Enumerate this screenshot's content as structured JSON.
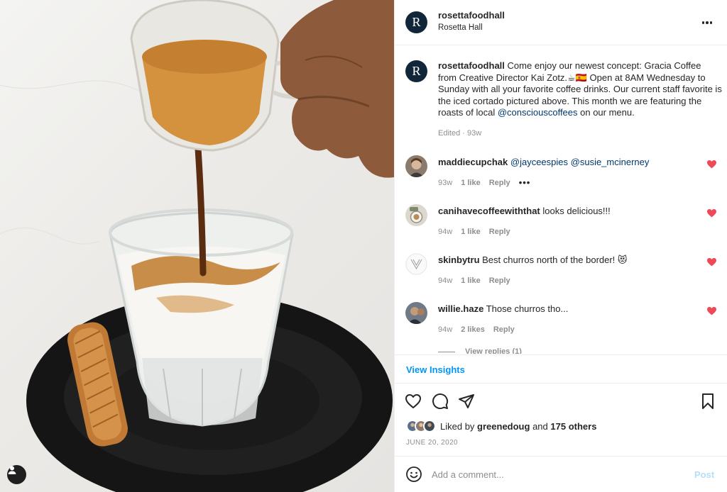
{
  "post": {
    "username": "rosettafoodhall",
    "location": "Rosetta Hall",
    "avatar_letter": "R",
    "avatar_color": "#12263a"
  },
  "caption": {
    "username": "rosettafoodhall",
    "text_part1": "Come enjoy our newest concept: Gracia Coffee from Creative Director Kai Zotz.",
    "emojis": "☕🇪🇸",
    "text_part2": " Open at 8AM Wednesday to Sunday with all your favorite coffee drinks. Our current staff favorite is the iced cortado pictured above. This month we are featuring the roasts of local ",
    "mention": "@consciouscoffees",
    "text_part3": " on our menu.",
    "meta": "Edited · 93w"
  },
  "comments": [
    {
      "username": "maddiecupchak",
      "text": "",
      "mentions": [
        "@jayceespies",
        "@susie_mcinerney"
      ],
      "time": "93w",
      "likes": "1 like",
      "reply": "Reply",
      "more": "•••"
    },
    {
      "username": "canihavecoffeewiththat",
      "text": "looks delicious!!!",
      "time": "94w",
      "likes": "1 like",
      "reply": "Reply"
    },
    {
      "username": "skinbytru",
      "text": "Best churros north of the border! 😻",
      "time": "94w",
      "likes": "1 like",
      "reply": "Reply"
    },
    {
      "username": "willie.haze",
      "text": "Those churros tho...",
      "time": "94w",
      "likes": "2 likes",
      "reply": "Reply"
    }
  ],
  "view_replies": "View replies (1)",
  "insights_label": "View Insights",
  "likes": {
    "prefix": "Liked by",
    "user": "greenedoug",
    "connector": "and",
    "others": "175 others"
  },
  "date": "JUNE 20, 2020",
  "comment_box": {
    "placeholder": "Add a comment...",
    "post_label": "Post"
  },
  "icons": {
    "header_more": "more-horizontal-icon",
    "like": "heart-outline-icon",
    "comment": "comment-bubble-icon",
    "share": "paper-plane-icon",
    "save": "bookmark-icon",
    "emoji": "smiley-face-icon",
    "comment_like": "heart-filled-icon",
    "user_tag": "user-tag-icon"
  },
  "colors": {
    "link": "#0095f6",
    "mention": "#00376b",
    "heart": "#ed4956",
    "post_disabled": "#b2dffc",
    "secondary_text": "#8e8e8e"
  }
}
